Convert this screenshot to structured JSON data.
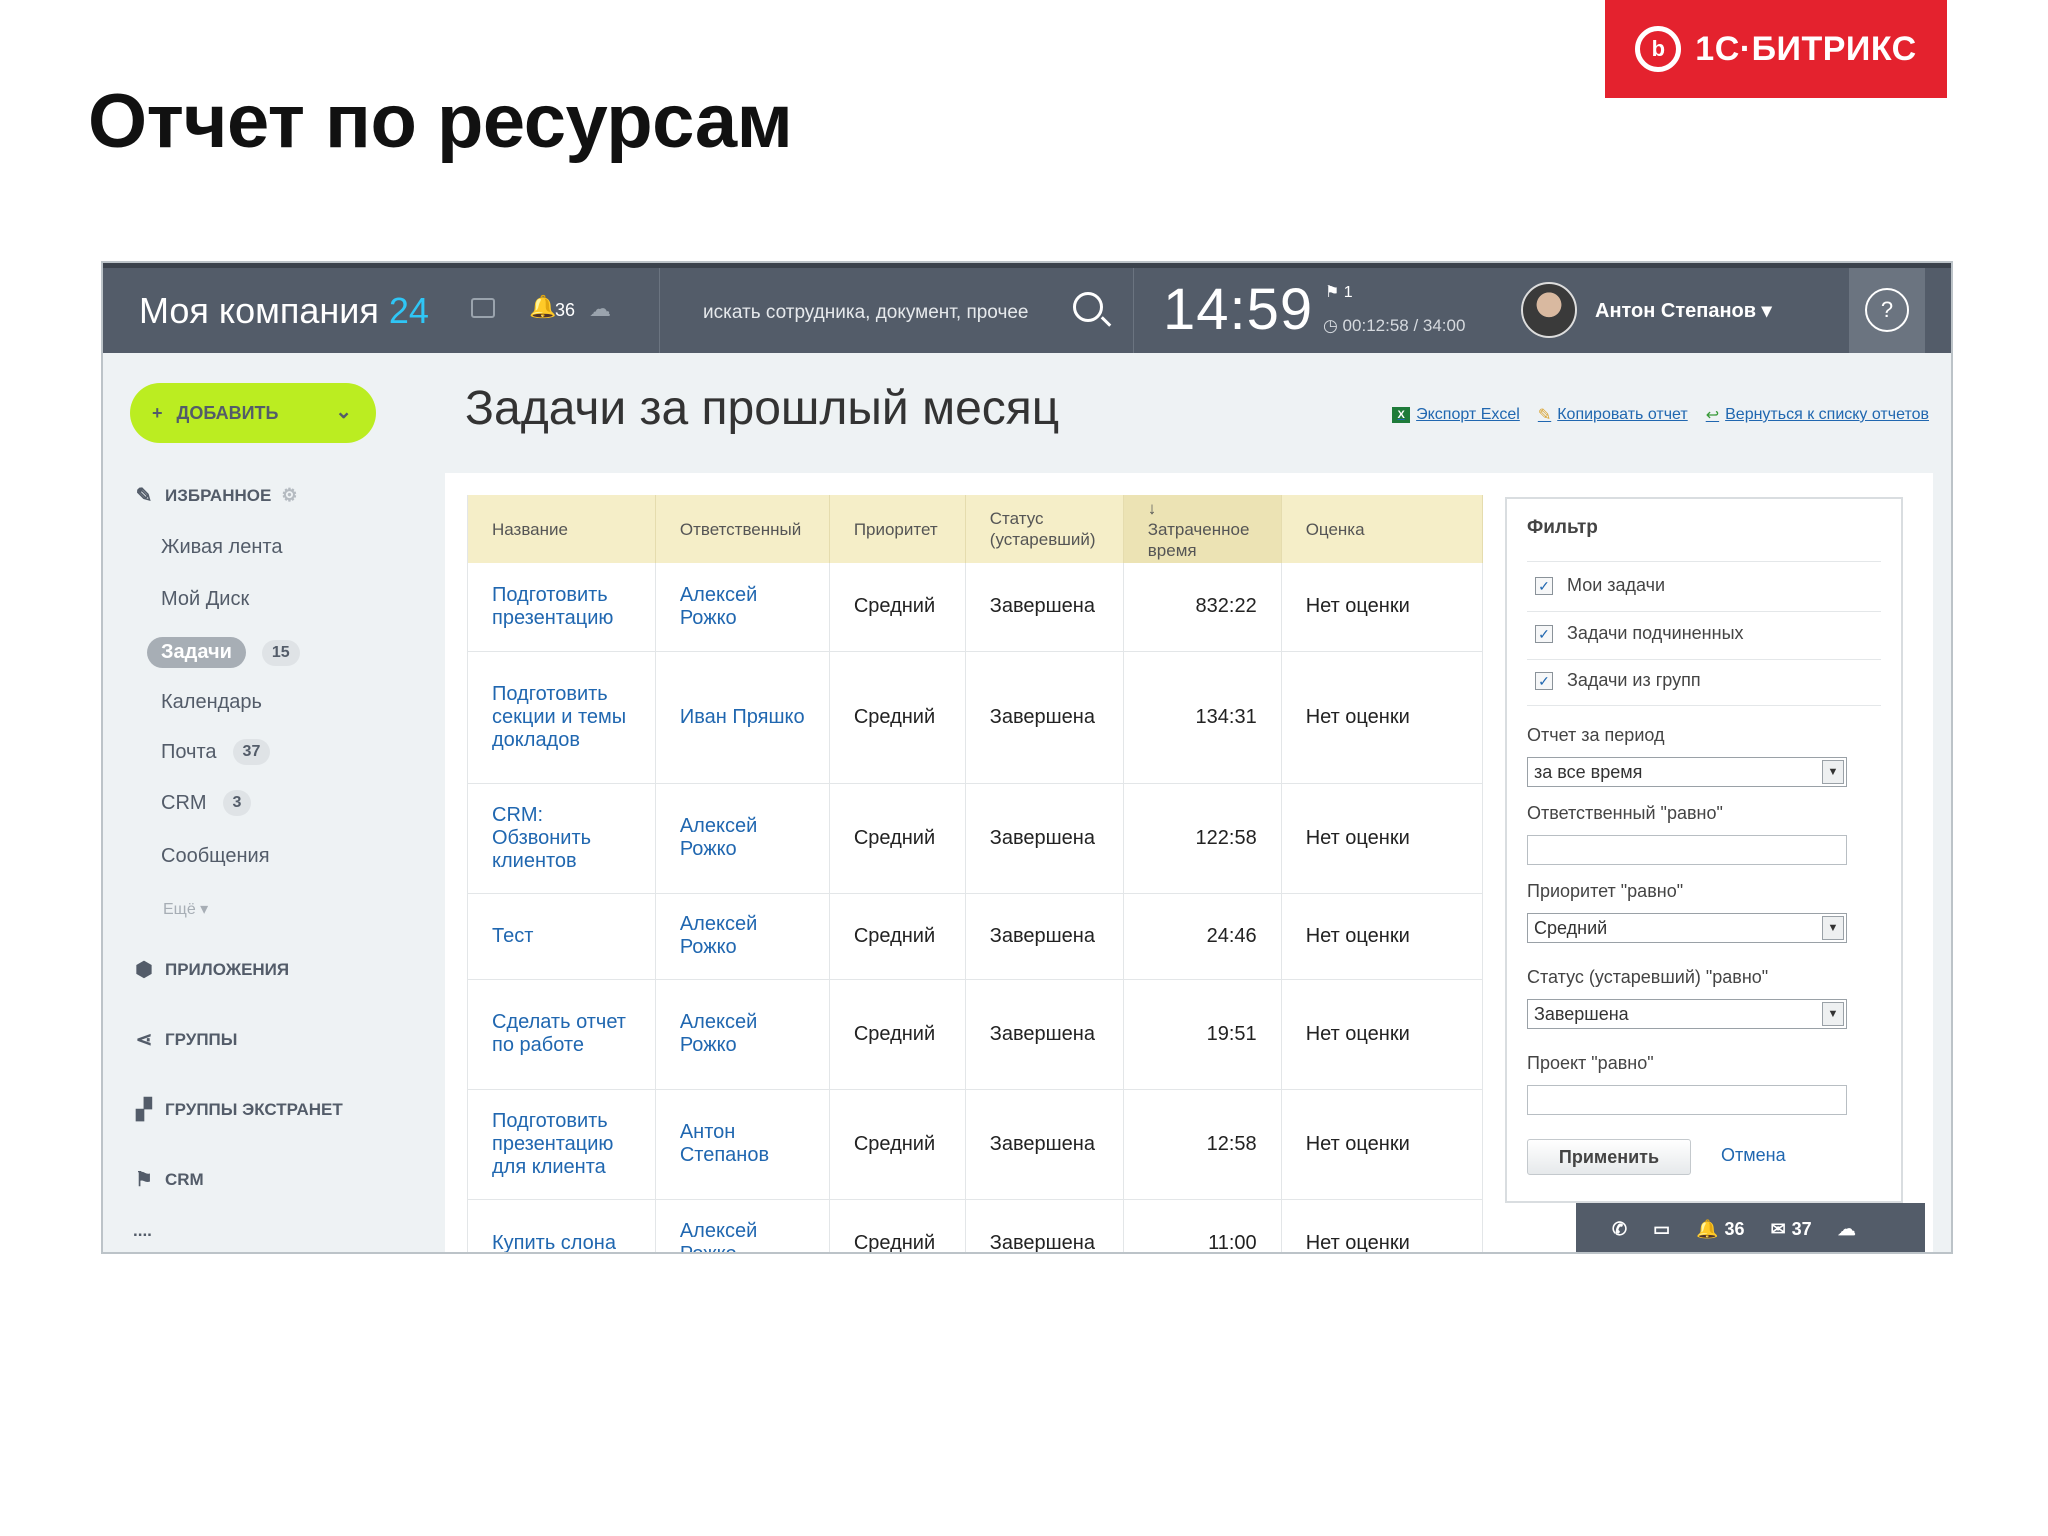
{
  "slide": {
    "title": "Отчет по ресурсам",
    "logo_text": "1С·БИТРИКС",
    "logo_mark": "b",
    "brand_color": "#e4222e"
  },
  "topbar": {
    "company": "Моя компания",
    "company_num": "24",
    "chat_icon": "chat-icon",
    "bell_symbol": "🔔",
    "notifications": "36",
    "cloud_symbol": "☁",
    "search_placeholder": "искать сотрудника, документ, прочее",
    "time": "14:59",
    "flag": "⚑ 1",
    "work_time": "◷ 00:12:58 / 34:00",
    "user": "Антон Степанов",
    "user_chevron": "▾",
    "help": "?"
  },
  "sidebar": {
    "add_button": "ДОБАВИТЬ",
    "add_plus": "+",
    "add_chevron": "⌄",
    "favorites": "ИЗБРАННОЕ",
    "gear": "⚙",
    "items": [
      {
        "label": "Живая лента"
      },
      {
        "label": "Мой Диск"
      },
      {
        "label": "Задачи",
        "count": "15"
      },
      {
        "label": "Календарь"
      },
      {
        "label": "Почта",
        "count": "37"
      },
      {
        "label": "CRM",
        "count": "3"
      },
      {
        "label": "Сообщения"
      }
    ],
    "more": "Ещё ▾",
    "sections": {
      "apps": "ПРИЛОЖЕНИЯ",
      "groups": "ГРУППЫ",
      "extranet": "ГРУППЫ ЭКСТРАНЕТ",
      "crm": "CRM",
      "dots": "...."
    },
    "section_icons": {
      "favorites": "✎",
      "apps": "⬢",
      "groups": "⋖",
      "extranet": "▞",
      "crm": "⚑"
    }
  },
  "main": {
    "title": "Задачи за прошлый месяц",
    "links": {
      "export": "Экспорт Excel",
      "copy": "Копировать отчет",
      "back": "Вернуться к списку отчетов",
      "export_icon": "X",
      "copy_icon": "✎",
      "back_icon": "↩"
    }
  },
  "table": {
    "headers": [
      "Название",
      "Ответственный",
      "Приоритет",
      "Статус (устаревший)",
      "↓ Затраченное время",
      "Оценка"
    ],
    "rows": [
      {
        "name": "Подготовить презентацию",
        "resp": "Алексей Рожко",
        "priority": "Средний",
        "status": "Завершена",
        "time": "832:22",
        "rating": "Нет оценки"
      },
      {
        "name": "Подготовить секции и темы докладов",
        "resp": "Иван Пряшко",
        "priority": "Средний",
        "status": "Завершена",
        "time": "134:31",
        "rating": "Нет оценки"
      },
      {
        "name": "CRM: Обзвонить клиентов",
        "resp": "Алексей Рожко",
        "priority": "Средний",
        "status": "Завершена",
        "time": "122:58",
        "rating": "Нет оценки"
      },
      {
        "name": "Тест",
        "resp": "Алексей Рожко",
        "priority": "Средний",
        "status": "Завершена",
        "time": "24:46",
        "rating": "Нет оценки"
      },
      {
        "name": "Сделать отчет по работе",
        "resp": "Алексей Рожко",
        "priority": "Средний",
        "status": "Завершена",
        "time": "19:51",
        "rating": "Нет оценки"
      },
      {
        "name": "Подготовить презентацию для клиента",
        "resp": "Антон Степанов",
        "priority": "Средний",
        "status": "Завершена",
        "time": "12:58",
        "rating": "Нет оценки"
      },
      {
        "name": "Купить слона",
        "resp": "Алексей Рожко",
        "priority": "Средний",
        "status": "Завершена",
        "time": "11:00",
        "rating": "Нет оценки"
      }
    ]
  },
  "filter": {
    "title": "Фильтр",
    "checks": [
      "Мои задачи",
      "Задачи подчиненных",
      "Задачи из групп"
    ],
    "check_mark": "✓",
    "period_label": "Отчет за период",
    "period_value": "за все время",
    "resp_label": "Ответственный \"равно\"",
    "priority_label": "Приоритет \"равно\"",
    "priority_value": "Средний",
    "status_label": "Статус (устаревший) \"равно\"",
    "status_value": "Завершена",
    "project_label": "Проект \"равно\"",
    "select_arrow": "▼",
    "apply": "Применить",
    "cancel": "Отмена"
  },
  "bottombar": {
    "phone": "✆",
    "chat": "▭",
    "bell": "🔔",
    "notifications": "36",
    "mail": "✉",
    "mail_count": "37",
    "cloud": "☁"
  }
}
